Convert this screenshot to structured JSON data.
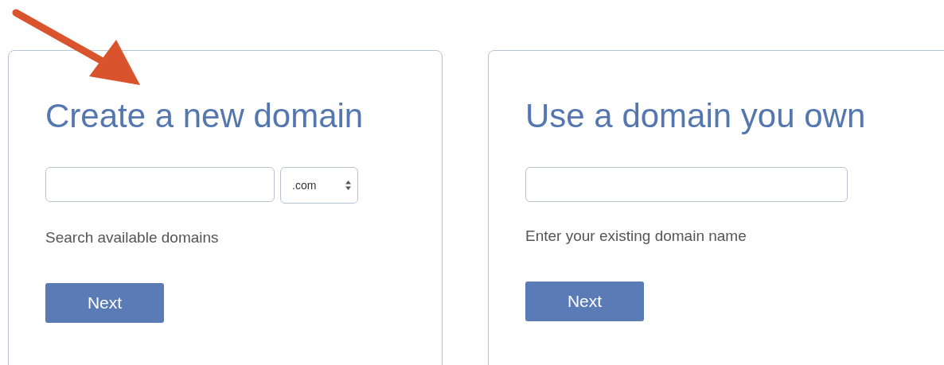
{
  "cards": [
    {
      "kind": "search",
      "title": "Create a new domain",
      "select": {
        "value": ".com"
      },
      "hint": "Search available domains",
      "button": "Next"
    },
    {
      "kind": "existing",
      "title": "Use a domain you own",
      "hint": "Enter your existing domain name",
      "button": "Next"
    }
  ]
}
